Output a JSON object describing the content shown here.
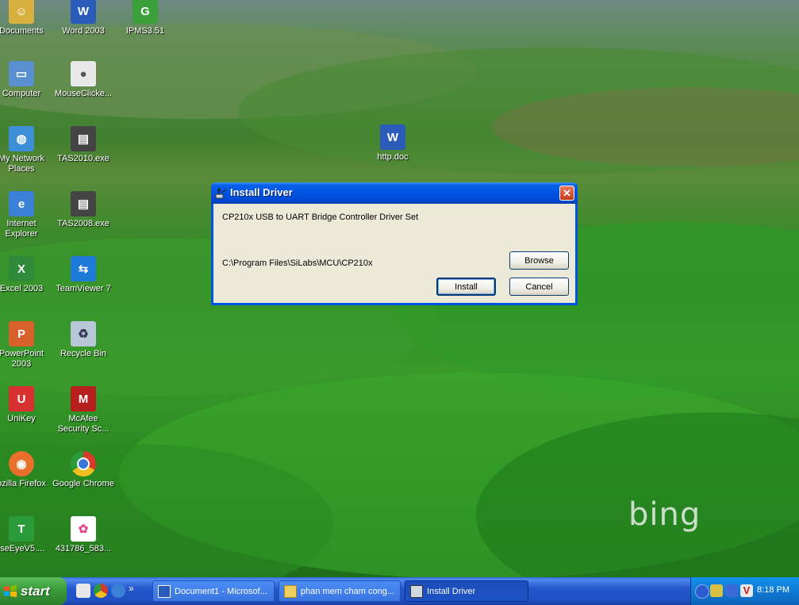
{
  "desktop": {
    "watermark": "bing",
    "icons": [
      {
        "label": "Documents",
        "name": "documents-icon",
        "color": "#d8b040"
      },
      {
        "label": "Word 2003",
        "name": "word-icon",
        "color": "#2a5bb8"
      },
      {
        "label": "IPMS3.51",
        "name": "ipms-icon",
        "color": "#3aa03a"
      },
      {
        "label": "Computer",
        "name": "computer-icon",
        "color": "#5a8fd0"
      },
      {
        "label": "MouseClicke...",
        "name": "mouse-icon",
        "color": "#e8e8e8"
      },
      {
        "label": "My Network Places",
        "name": "network-icon",
        "color": "#3d8fd8"
      },
      {
        "label": "TAS2010.exe",
        "name": "tas2010-icon",
        "color": "#444"
      },
      {
        "label": "http.doc",
        "name": "doc-file-icon",
        "color": "#2a5bb8"
      },
      {
        "label": "Internet Explorer",
        "name": "ie-icon",
        "color": "#3a7fd8"
      },
      {
        "label": "TAS2008.exe",
        "name": "tas2008-icon",
        "color": "#444"
      },
      {
        "label": "Excel 2003",
        "name": "excel-icon",
        "color": "#2f8a3a"
      },
      {
        "label": "TeamViewer 7",
        "name": "teamviewer-icon",
        "color": "#1e7ad8"
      },
      {
        "label": "PowerPoint 2003",
        "name": "powerpoint-icon",
        "color": "#d8602a"
      },
      {
        "label": "Recycle Bin",
        "name": "recycle-bin-icon",
        "color": "#b8c8d8"
      },
      {
        "label": "UniKey",
        "name": "unikey-icon",
        "color": "#d83030"
      },
      {
        "label": "McAfee Security Sc...",
        "name": "mcafee-icon",
        "color": "#b81e1e"
      },
      {
        "label": "ozilla Firefox",
        "name": "firefox-icon",
        "color": "#e8702a"
      },
      {
        "label": "Google Chrome",
        "name": "chrome-icon",
        "color": "#d8a020"
      },
      {
        "label": "iseEyeV5....",
        "name": "wiseeye-icon",
        "color": "#2a9a3a"
      },
      {
        "label": "431786_583...",
        "name": "image-file-icon",
        "color": "#e84a8a"
      }
    ]
  },
  "dialog": {
    "title": "Install Driver",
    "description": "CP210x USB to UART Bridge Controller Driver Set",
    "path": "C:\\Program Files\\SiLabs\\MCU\\CP210x",
    "browse_label": "Browse",
    "install_label": "Install",
    "cancel_label": "Cancel",
    "close_glyph": "✕"
  },
  "taskbar": {
    "start_label": "start",
    "tasks": [
      {
        "label": "Document1 - Microsof...",
        "active": false
      },
      {
        "label": "phan mem cham cong...",
        "active": false
      },
      {
        "label": "Install Driver",
        "active": true
      }
    ],
    "quick_launch_more": "»",
    "clock": "8:18 PM"
  },
  "colors": {
    "titlebar": "#0054e3",
    "dialog_bg": "#ece9d8",
    "taskbar": "#245edb",
    "start": "#3a9b3a",
    "tray": "#0f7ad6"
  }
}
